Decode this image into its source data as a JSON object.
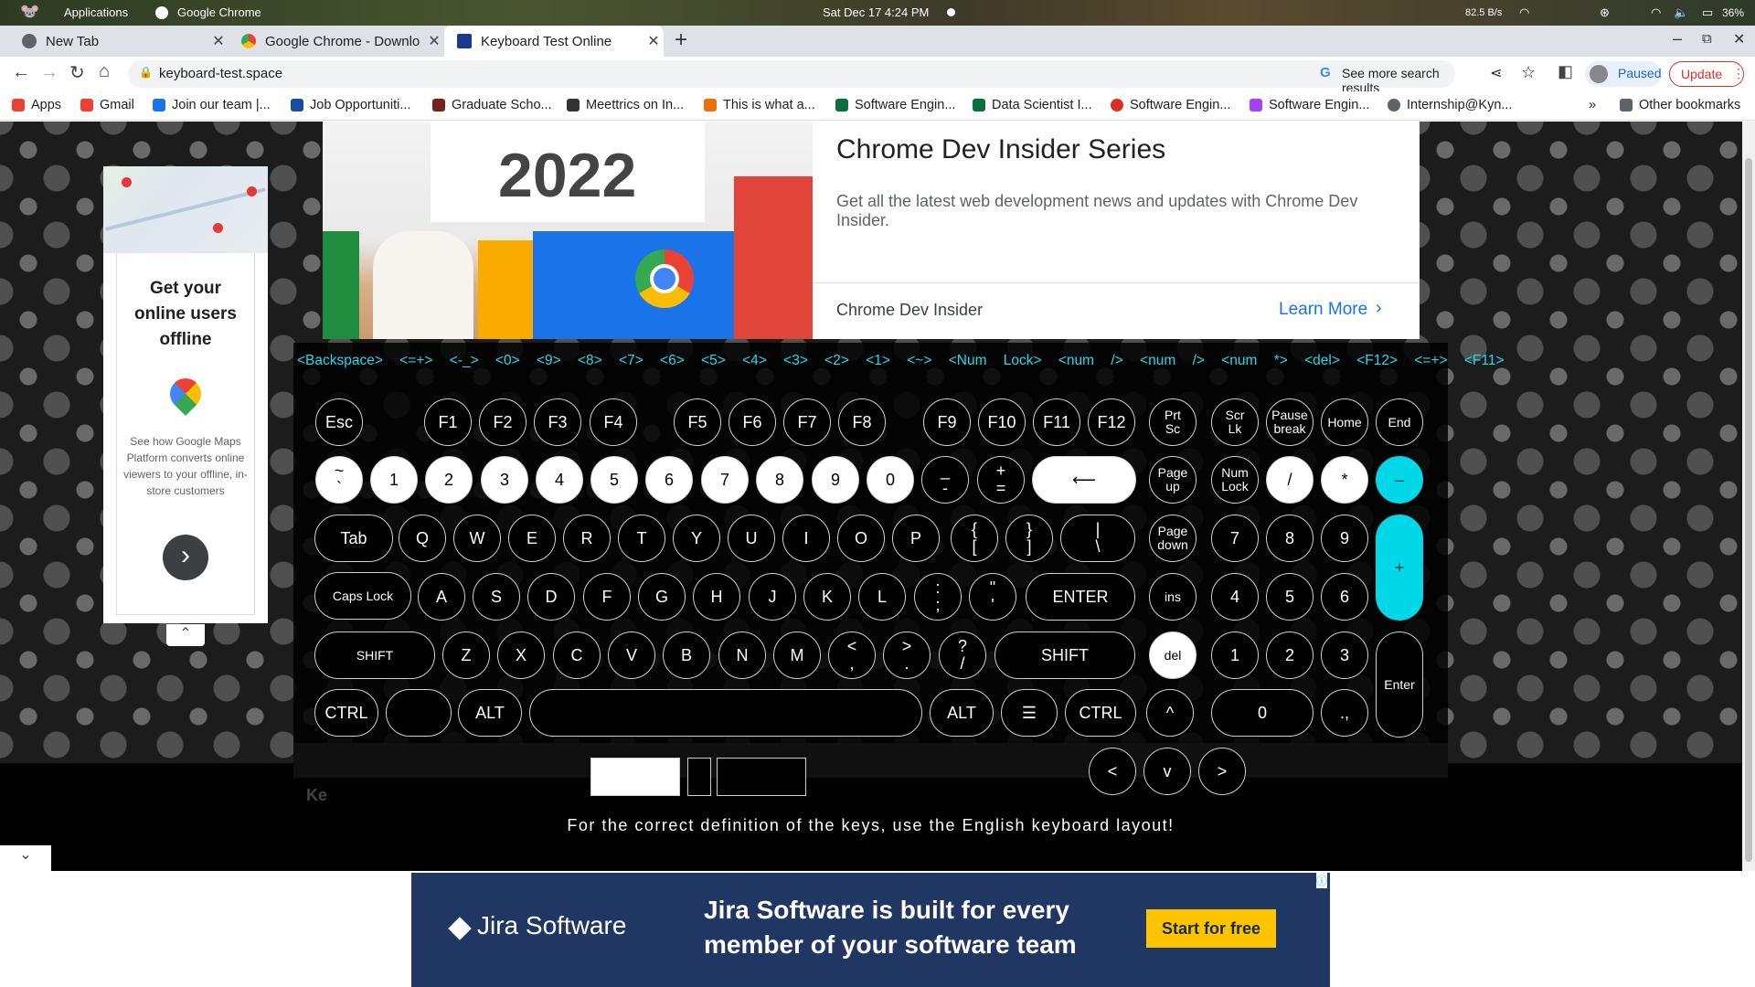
{
  "os": {
    "applications": "Applications",
    "app": "Google Chrome",
    "datetime": "Sat Dec 17   4:24 PM",
    "netspeed": "82.5 B/s",
    "battery": "36%"
  },
  "tabs": [
    {
      "label": "New Tab",
      "icon": "chrome-icon"
    },
    {
      "label": "Google Chrome - Downlo",
      "icon": "chrome-logo-icon"
    },
    {
      "label": "Keyboard Test Online",
      "icon": "ee-icon"
    }
  ],
  "newtab": "+",
  "toolbar": {
    "url": "keyboard-test.space",
    "search_more": "See more search results",
    "paused": "Paused",
    "update": "Update"
  },
  "bookmarks": [
    {
      "label": "Apps",
      "color": "#ea4335"
    },
    {
      "label": "Gmail",
      "color": "#ea4335"
    },
    {
      "label": "Join our team |...",
      "color": "#1a73e8"
    },
    {
      "label": "Job Opportuniti...",
      "color": "#1a4da1"
    },
    {
      "label": "Graduate Scho...",
      "color": "#7a1f1f"
    },
    {
      "label": "Meettrics on In...",
      "color": "#333333"
    },
    {
      "label": "This is what a...",
      "color": "#e8710a"
    },
    {
      "label": "Software Engin...",
      "color": "#0b6e3c"
    },
    {
      "label": "Data Scientist I...",
      "color": "#0b6e3c"
    },
    {
      "label": "Software Engin...",
      "color": "#d93025"
    },
    {
      "label": "Software Engin...",
      "color": "#a142f4"
    },
    {
      "label": "Internship@Kyn...",
      "color": "#5f6368"
    }
  ],
  "other_bookmarks": "Other bookmarks",
  "topad": {
    "year": "2022",
    "title": "Chrome Dev Insider Series",
    "desc": "Get all the latest web development news and updates with Chrome Dev Insider.",
    "brand": "Chrome Dev Insider",
    "cta": "Learn More"
  },
  "sidead": {
    "headline": "Get your online users offline",
    "body": "See how Google Maps Platform converts online viewers to your offline, in-store customers"
  },
  "history": "<Backspace> <=+> <-_> <0> <9> <8> <7> <6> <5> <4> <3> <2> <1> <~> <Num Lock> <num /> <num /> <num *> <del> <F12> <=+> <F11>",
  "rows": [
    [
      [
        "Esc",
        ""
      ],
      [
        "F1",
        ""
      ],
      [
        "F2",
        ""
      ],
      [
        "F3",
        ""
      ],
      [
        "F4",
        ""
      ],
      [
        "F5",
        ""
      ],
      [
        "F6",
        ""
      ],
      [
        "F7",
        ""
      ],
      [
        "F8",
        ""
      ],
      [
        "F9",
        ""
      ],
      [
        "F10",
        ""
      ],
      [
        "F11",
        ""
      ],
      [
        "F12",
        ""
      ]
    ],
    [
      [
        "~\n`",
        ""
      ],
      [
        "1",
        ""
      ],
      [
        "2",
        ""
      ],
      [
        "3",
        ""
      ],
      [
        "4",
        ""
      ],
      [
        "5",
        ""
      ],
      [
        "6",
        ""
      ],
      [
        "7",
        ""
      ],
      [
        "8",
        ""
      ],
      [
        "9",
        ""
      ],
      [
        "0",
        ""
      ],
      [
        "_\n-",
        ""
      ],
      [
        "+\n=",
        ""
      ],
      [
        "⟵",
        ""
      ]
    ],
    [
      [
        "Tab",
        ""
      ],
      [
        "Q",
        ""
      ],
      [
        "W",
        ""
      ],
      [
        "E",
        ""
      ],
      [
        "R",
        ""
      ],
      [
        "T",
        ""
      ],
      [
        "Y",
        ""
      ],
      [
        "U",
        ""
      ],
      [
        "I",
        ""
      ],
      [
        "O",
        ""
      ],
      [
        "P",
        ""
      ],
      [
        "{\n[",
        ""
      ],
      [
        "}\n]",
        ""
      ],
      [
        "|\n\\",
        ""
      ]
    ],
    [
      [
        "Caps Lock",
        ""
      ],
      [
        "A",
        ""
      ],
      [
        "S",
        ""
      ],
      [
        "D",
        ""
      ],
      [
        "F",
        ""
      ],
      [
        "G",
        ""
      ],
      [
        "H",
        ""
      ],
      [
        "J",
        ""
      ],
      [
        "K",
        ""
      ],
      [
        "L",
        ""
      ],
      [
        ":\n;",
        ""
      ],
      [
        "\"\n'",
        ""
      ],
      [
        "ENTER",
        ""
      ]
    ],
    [
      [
        "SHIFT",
        ""
      ],
      [
        "Z",
        ""
      ],
      [
        "X",
        ""
      ],
      [
        "C",
        ""
      ],
      [
        "V",
        ""
      ],
      [
        "B",
        ""
      ],
      [
        "N",
        ""
      ],
      [
        "M",
        ""
      ],
      [
        "<\n,",
        ""
      ],
      [
        ">\n.",
        ""
      ],
      [
        "?\n/",
        ""
      ],
      [
        "SHIFT",
        ""
      ]
    ],
    [
      [
        "CTRL",
        ""
      ],
      [
        "",
        ""
      ],
      [
        "ALT",
        ""
      ],
      [
        "",
        ""
      ],
      [
        "ALT",
        ""
      ],
      [
        "☰",
        ""
      ],
      [
        "CTRL",
        ""
      ]
    ]
  ],
  "nav": [
    [
      "Prt\nSc",
      ""
    ],
    [
      "Scr\nLk",
      ""
    ],
    [
      "Pause\nbreak",
      ""
    ],
    [
      "Home",
      ""
    ],
    [
      "End",
      ""
    ],
    [
      "Page\nup",
      ""
    ],
    [
      "Page\ndown",
      ""
    ],
    [
      "ins",
      ""
    ],
    [
      "del",
      ""
    ],
    [
      "^",
      ""
    ],
    [
      "<",
      ""
    ],
    [
      "v",
      ""
    ],
    [
      ">",
      ""
    ]
  ],
  "numpad": [
    [
      "Num\nLock",
      ""
    ],
    [
      "/",
      ""
    ],
    [
      "*",
      ""
    ],
    [
      "–",
      ""
    ],
    [
      "7",
      ""
    ],
    [
      "8",
      ""
    ],
    [
      "9",
      ""
    ],
    [
      "+",
      ""
    ],
    [
      "4",
      ""
    ],
    [
      "5",
      ""
    ],
    [
      "6",
      ""
    ],
    [
      "1",
      ""
    ],
    [
      "2",
      ""
    ],
    [
      "3",
      ""
    ],
    [
      "Enter",
      ""
    ],
    [
      "0",
      ""
    ],
    [
      ".,",
      ""
    ]
  ],
  "footer_note": "For the correct definition of the keys, use the English keyboard layout!",
  "bottomad": {
    "brand": "Jira Software",
    "headline": "Jira Software is built for every member of your software team",
    "cta": "Start for free"
  },
  "colors": {
    "accent": "#00d8e8",
    "history": "#23d9ee",
    "jira_bg": "#203764",
    "jira_cta": "#ffc400"
  }
}
